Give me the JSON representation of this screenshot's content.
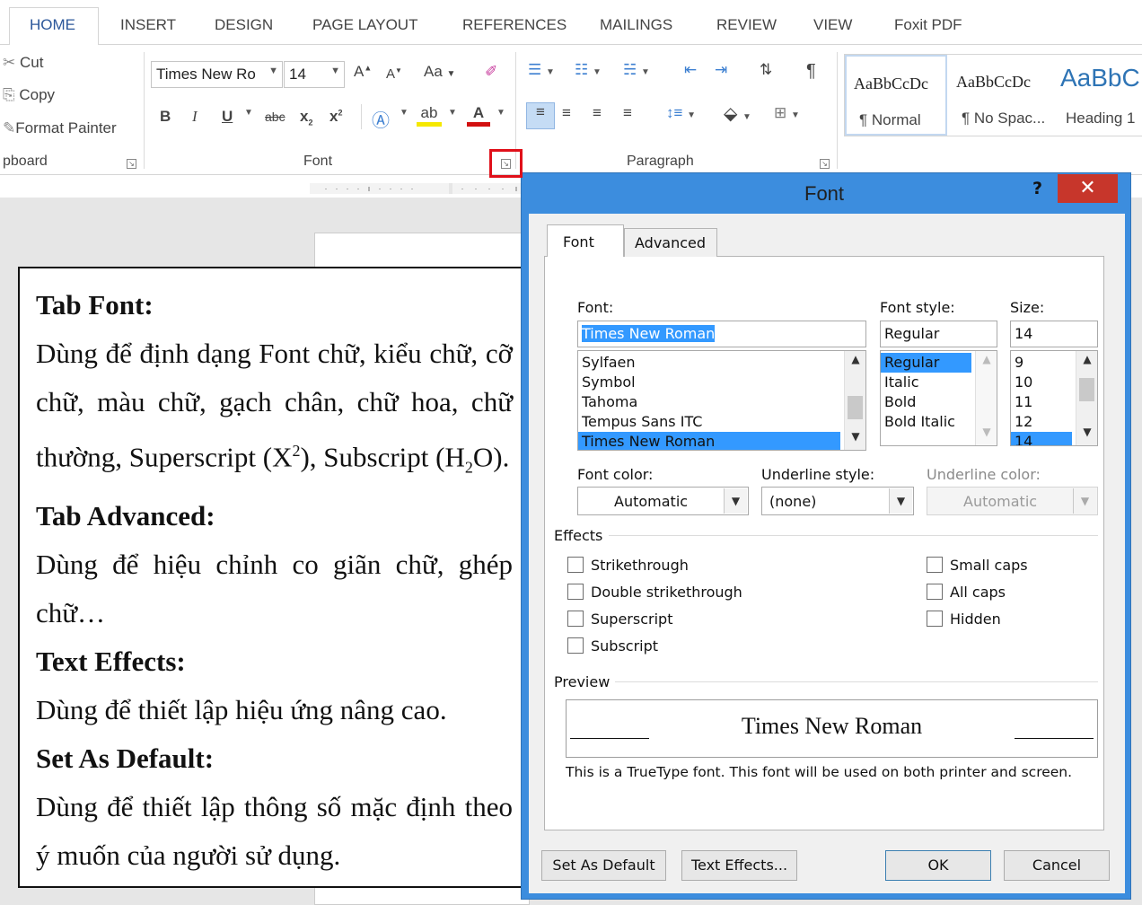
{
  "ribbon_tabs": [
    "HOME",
    "INSERT",
    "DESIGN",
    "PAGE LAYOUT",
    "REFERENCES",
    "MAILINGS",
    "REVIEW",
    "VIEW",
    "Foxit PDF"
  ],
  "clipboard": {
    "cut": "Cut",
    "copy": "Copy",
    "format_painter": "Format Painter",
    "label": "pboard"
  },
  "font_group": {
    "font_name": "Times New Ro",
    "font_size": "14",
    "grow": "A",
    "shrink": "A",
    "change_case": "Aa",
    "bold": "B",
    "italic": "I",
    "underline": "U",
    "strike": "abc",
    "sub": "x",
    "sup": "x",
    "label": "Font"
  },
  "paragraph_group": {
    "label": "Paragraph",
    "show_marks": "¶"
  },
  "styles": [
    {
      "preview": "AaBbCcDc",
      "name": "¶ Normal"
    },
    {
      "preview": "AaBbCcDc",
      "name": "¶ No Spac..."
    },
    {
      "preview": "AaBbC",
      "name": "Heading 1"
    }
  ],
  "callout": {
    "h1": "Tab Font:",
    "p1a": "Dùng để định dạng Font chữ, kiểu chữ, cỡ chữ, màu chữ, gạch chân, chữ hoa, chữ thường, Superscript (X",
    "p1_sup": "2",
    "p1b": "), Subscript (H",
    "p1_sub": "2",
    "p1c": "O).",
    "h2": "Tab Advanced:",
    "p2": "Dùng để hiệu chỉnh co giãn chữ, ghép chữ…",
    "h3": "Text Effects:",
    "p3": "Dùng để thiết lập hiệu ứng nâng cao.",
    "h4": "Set As Default:",
    "p4": "Dùng để thiết lập thông số mặc định theo ý muốn của người sử dụng."
  },
  "dialog": {
    "title": "Font",
    "help": "?",
    "close": "✕",
    "tabs": [
      "Font",
      "Advanced"
    ],
    "font_label": "Font:",
    "font_value": "Times New Roman",
    "font_list": [
      "Sylfaen",
      "Symbol",
      "Tahoma",
      "Tempus Sans ITC",
      "Times New Roman"
    ],
    "style_label": "Font style:",
    "style_value": "Regular",
    "style_list": [
      "Regular",
      "Italic",
      "Bold",
      "Bold Italic"
    ],
    "size_label": "Size:",
    "size_value": "14",
    "size_list": [
      "9",
      "10",
      "11",
      "12",
      "14"
    ],
    "font_color_label": "Font color:",
    "font_color_value": "Automatic",
    "underline_style_label": "Underline style:",
    "underline_style_value": "(none)",
    "underline_color_label": "Underline color:",
    "underline_color_value": "Automatic",
    "effects_label": "Effects",
    "effects_left": [
      "Strikethrough",
      "Double strikethrough",
      "Superscript",
      "Subscript"
    ],
    "effects_right": [
      "Small caps",
      "All caps",
      "Hidden"
    ],
    "preview_label": "Preview",
    "preview_text": "Times New Roman",
    "preview_note": "This is a TrueType font. This font will be used on both printer and screen.",
    "buttons": {
      "set_default": "Set As Default",
      "text_effects": "Text Effects...",
      "ok": "OK",
      "cancel": "Cancel"
    }
  },
  "colors": {
    "accent": "#2b579a",
    "dialog_frame": "#3c8dde",
    "close_red": "#c7362b",
    "selection": "#3399ff",
    "highlight_box": "#e0101a"
  }
}
